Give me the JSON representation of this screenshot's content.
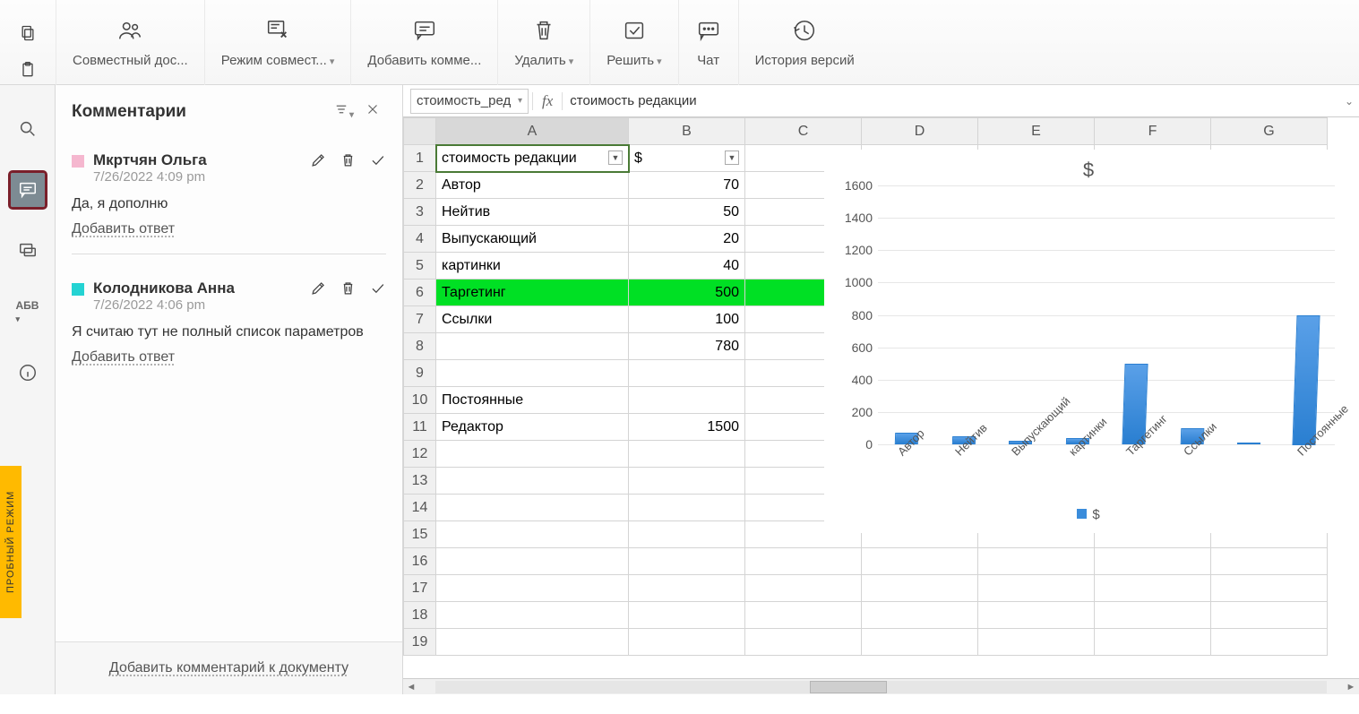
{
  "toolbar": {
    "share_label": "Совместный дос...",
    "coedit_label": "Режим совмест...",
    "add_comment_label": "Добавить комме...",
    "delete_label": "Удалить",
    "resolve_label": "Решить",
    "chat_label": "Чат",
    "history_label": "История версий"
  },
  "leftrail": {
    "trial_text": "ПРОБНЫЙ РЕЖИМ"
  },
  "comments": {
    "title": "Комментарии",
    "add_doc_comment": "Добавить комментарий к документу",
    "items": [
      {
        "author": "Мкртчян Ольга",
        "time": "7/26/2022 4:09 pm",
        "color": "#f5b7cf",
        "text": "Да, я дополню",
        "reply_label": "Добавить ответ"
      },
      {
        "author": "Колодникова Анна",
        "time": "7/26/2022 4:06 pm",
        "color": "#24d3d3",
        "text": "Я считаю тут не полный список параметров",
        "reply_label": "Добавить ответ"
      }
    ]
  },
  "formula_bar": {
    "namebox": "стоимость_ред",
    "fx_label": "fx",
    "value": "стоимость редакции"
  },
  "sheet": {
    "columns": [
      "A",
      "B",
      "C",
      "D",
      "E",
      "F",
      "G"
    ],
    "rows": [
      {
        "n": 1,
        "A": "стоимость редакции",
        "B": "$",
        "filterA": true,
        "filterB": true,
        "active": true
      },
      {
        "n": 2,
        "A": "Автор",
        "B": "70"
      },
      {
        "n": 3,
        "A": "Нейтив",
        "B": "50"
      },
      {
        "n": 4,
        "A": "Выпускающий",
        "B": "20"
      },
      {
        "n": 5,
        "A": "картинки",
        "B": "40"
      },
      {
        "n": 6,
        "A": "Таргетинг",
        "B": "500",
        "highlight": true
      },
      {
        "n": 7,
        "A": "Ссылки",
        "B": "100"
      },
      {
        "n": 8,
        "A": "",
        "B": "780"
      },
      {
        "n": 9,
        "A": "",
        "B": ""
      },
      {
        "n": 10,
        "A": "Постоянные",
        "B": ""
      },
      {
        "n": 11,
        "A": "Редактор",
        "B": "1500"
      },
      {
        "n": 12,
        "A": "",
        "B": ""
      },
      {
        "n": 13,
        "A": "",
        "B": ""
      },
      {
        "n": 14,
        "A": "",
        "B": ""
      },
      {
        "n": 15,
        "A": "",
        "B": ""
      },
      {
        "n": 16,
        "A": "",
        "B": ""
      },
      {
        "n": 17,
        "A": "",
        "B": ""
      },
      {
        "n": 18,
        "A": "",
        "B": ""
      },
      {
        "n": 19,
        "A": "",
        "B": ""
      }
    ]
  },
  "chart_data": {
    "type": "bar",
    "title": "$",
    "ylim": [
      0,
      1600
    ],
    "yticks": [
      0,
      200,
      400,
      600,
      800,
      1000,
      1200,
      1400,
      1600
    ],
    "categories": [
      "Автор",
      "Нейтив",
      "Выпускающий",
      "картинки",
      "Таргетинг",
      "Ссылки",
      "",
      "Постоянные"
    ],
    "values": [
      70,
      50,
      20,
      40,
      500,
      100,
      0,
      800
    ],
    "legend": "$"
  }
}
